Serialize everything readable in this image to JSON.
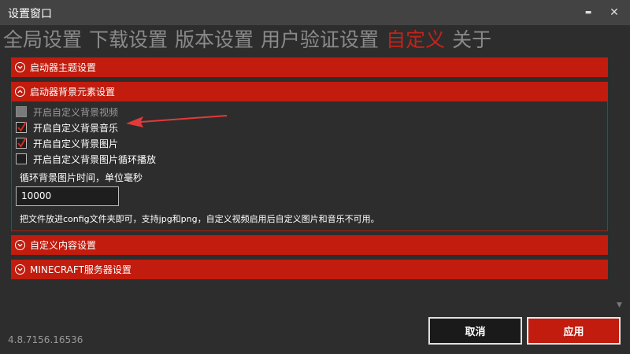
{
  "window": {
    "title": "设置窗口",
    "minimize": "▬",
    "close": "✕"
  },
  "tabs": [
    "全局设置",
    "下载设置",
    "版本设置",
    "用户验证设置",
    "自定义",
    "关于"
  ],
  "active_tab_index": 4,
  "sections": {
    "launcher_theme": {
      "label": "启动器主题设置",
      "expanded": false
    },
    "background": {
      "label": "启动器背景元素设置",
      "expanded": true,
      "options": [
        {
          "label": "开启自定义背景视频",
          "checked": false,
          "disabled": true
        },
        {
          "label": "开启自定义背景音乐",
          "checked": true,
          "disabled": false
        },
        {
          "label": "开启自定义背景图片",
          "checked": true,
          "disabled": false
        },
        {
          "label": "开启自定义背景图片循环播放",
          "checked": false,
          "disabled": false
        }
      ],
      "interval_label": "循环背景图片时间，单位毫秒",
      "interval_value": "10000",
      "info": "把文件放进config文件夹即可，支持jpg和png，自定义视频启用后自定义图片和音乐不可用。"
    },
    "custom_content": {
      "label": "自定义内容设置",
      "expanded": false
    },
    "minecraft_server": {
      "label": "MINECRAFT服务器设置",
      "expanded": false
    }
  },
  "footer": {
    "version": "4.8.7156.16536",
    "cancel_label": "取消",
    "apply_label": "应用"
  },
  "colors": {
    "accent": "#c11c0e",
    "background": "#2d2d2d",
    "titlebar": "#434343"
  }
}
